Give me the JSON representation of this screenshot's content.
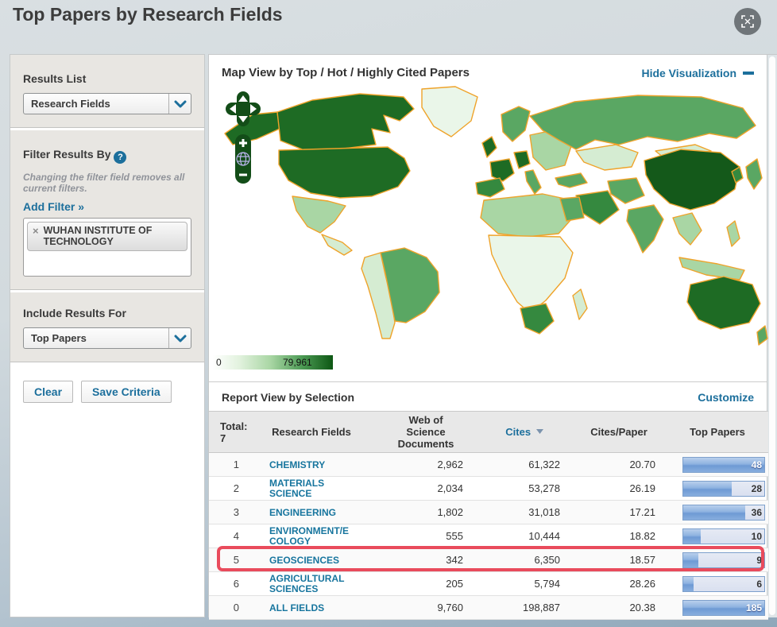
{
  "page": {
    "title": "Top Papers by Research Fields"
  },
  "sidebar": {
    "results_list": {
      "heading": "Results List",
      "dropdown_value": "Research Fields"
    },
    "filter": {
      "heading": "Filter Results By",
      "help": "?",
      "note": "Changing the filter field removes all current filters.",
      "add_filter_link": "Add Filter »",
      "active_filters": [
        {
          "remove_symbol": "×",
          "label": "WUHAN INSTITUTE OF TECHNOLOGY"
        }
      ]
    },
    "include_results": {
      "heading": "Include Results For",
      "dropdown_value": "Top Papers"
    },
    "actions": {
      "clear": "Clear",
      "save": "Save Criteria"
    }
  },
  "map": {
    "heading": "Map View by Top / Hot / Highly Cited Papers",
    "hide_link": "Hide Visualization",
    "legend": {
      "min": "0",
      "max": "79,961"
    },
    "palette": {
      "darkest": "#14591a",
      "dark": "#1e6b24",
      "mid_dark": "#35893f",
      "medium": "#5aa763",
      "light": "#a9d6a4",
      "pale": "#d5ecd2",
      "very_pale": "#eaf6e9",
      "border": "#efa32a"
    },
    "regions": {
      "alaska": "dark",
      "canada": "dark",
      "greenland": "very_pale",
      "usa": "dark",
      "mexico": "light",
      "central-america": "pale",
      "south-america-west": "pale",
      "brazil": "medium",
      "scandinavia": "medium",
      "uk": "dark",
      "iberia": "mid_dark",
      "france": "dark",
      "germany": "dark",
      "italy": "medium",
      "eastern-europe": "light",
      "russia": "medium",
      "kazakhstan": "pale",
      "turkey": "medium",
      "saudi-arabia": "mid_dark",
      "iran": "medium",
      "china": "darkest",
      "mongolia": "pale",
      "india": "medium",
      "southeast-asia": "light",
      "indonesia": "light",
      "philippines": "light",
      "japan": "medium",
      "korea": "mid_dark",
      "north-africa": "light",
      "egypt": "medium",
      "central-africa": "very_pale",
      "south-africa": "mid_dark",
      "madagascar": "pale",
      "australia": "dark",
      "new-zealand": "medium"
    }
  },
  "report": {
    "heading": "Report View by Selection",
    "customize_link": "Customize",
    "table": {
      "total_label": "Total:",
      "total_value": "7",
      "columns": {
        "fields": "Research Fields",
        "docs": "Web of Science Documents",
        "cites": "Cites",
        "cites_per_paper": "Cites/Paper",
        "top_papers": "Top Papers"
      },
      "sort": {
        "column": "Cites",
        "direction": "desc"
      },
      "rows": [
        {
          "rank": "1",
          "field_lines": [
            "CHEMISTRY"
          ],
          "docs": "2,962",
          "cites": "61,322",
          "cites_per_paper": "20.70",
          "top_papers": "48",
          "bar_pct": 100,
          "highlighted": false
        },
        {
          "rank": "2",
          "field_lines": [
            "MATERIALS",
            "SCIENCE"
          ],
          "docs": "2,034",
          "cites": "53,278",
          "cites_per_paper": "26.19",
          "top_papers": "28",
          "bar_pct": 60,
          "highlighted": false
        },
        {
          "rank": "3",
          "field_lines": [
            "ENGINEERING"
          ],
          "docs": "1,802",
          "cites": "31,018",
          "cites_per_paper": "17.21",
          "top_papers": "36",
          "bar_pct": 76,
          "highlighted": false
        },
        {
          "rank": "4",
          "field_lines": [
            "ENVIRONMENT/E",
            "COLOGY"
          ],
          "docs": "555",
          "cites": "10,444",
          "cites_per_paper": "18.82",
          "top_papers": "10",
          "bar_pct": 22,
          "highlighted": false
        },
        {
          "rank": "5",
          "field_lines": [
            "GEOSCIENCES"
          ],
          "docs": "342",
          "cites": "6,350",
          "cites_per_paper": "18.57",
          "top_papers": "9",
          "bar_pct": 19,
          "highlighted": true
        },
        {
          "rank": "6",
          "field_lines": [
            "AGRICULTURAL",
            "SCIENCES"
          ],
          "docs": "205",
          "cites": "5,794",
          "cites_per_paper": "28.26",
          "top_papers": "6",
          "bar_pct": 13,
          "highlighted": false
        },
        {
          "rank": "0",
          "field_lines": [
            "ALL FIELDS"
          ],
          "docs": "9,760",
          "cites": "198,887",
          "cites_per_paper": "20.38",
          "top_papers": "185",
          "bar_pct": 100,
          "highlighted": false
        }
      ]
    }
  },
  "colors": {
    "link": "#1c6f9c",
    "highlight_border": "#e94b5c",
    "title_text": "#3c3c3c"
  }
}
